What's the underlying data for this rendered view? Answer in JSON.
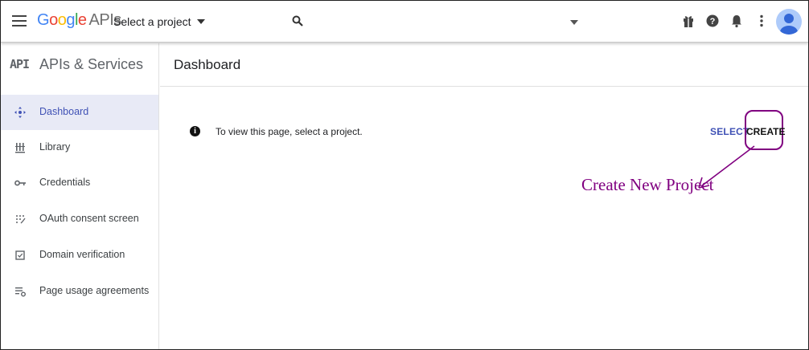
{
  "header": {
    "logo_google": "Google",
    "logo_apis": "APIs",
    "project_select": "Select a project",
    "icons": [
      "menu-icon",
      "search-icon",
      "gift-icon",
      "help-icon",
      "notifications-icon",
      "more-vert-icon",
      "account-avatar"
    ]
  },
  "sidebar": {
    "badge": "API",
    "title": "APIs & Services",
    "items": [
      {
        "label": "Dashboard",
        "icon": "dashboard-icon",
        "active": true
      },
      {
        "label": "Library",
        "icon": "library-icon",
        "active": false
      },
      {
        "label": "Credentials",
        "icon": "key-icon",
        "active": false
      },
      {
        "label": "OAuth consent screen",
        "icon": "consent-icon",
        "active": false
      },
      {
        "label": "Domain verification",
        "icon": "checkbox-icon",
        "active": false
      },
      {
        "label": "Page usage agreements",
        "icon": "settings-list-icon",
        "active": false
      }
    ]
  },
  "main": {
    "title": "Dashboard",
    "message": "To view this page, select a project.",
    "select_label": "SELECT",
    "create_label": "CREATE"
  },
  "annotation": {
    "text": "Create New Project",
    "color": "#800080"
  },
  "colors": {
    "accent": "#3f51b5",
    "active_bg": "#e8eaf6"
  }
}
